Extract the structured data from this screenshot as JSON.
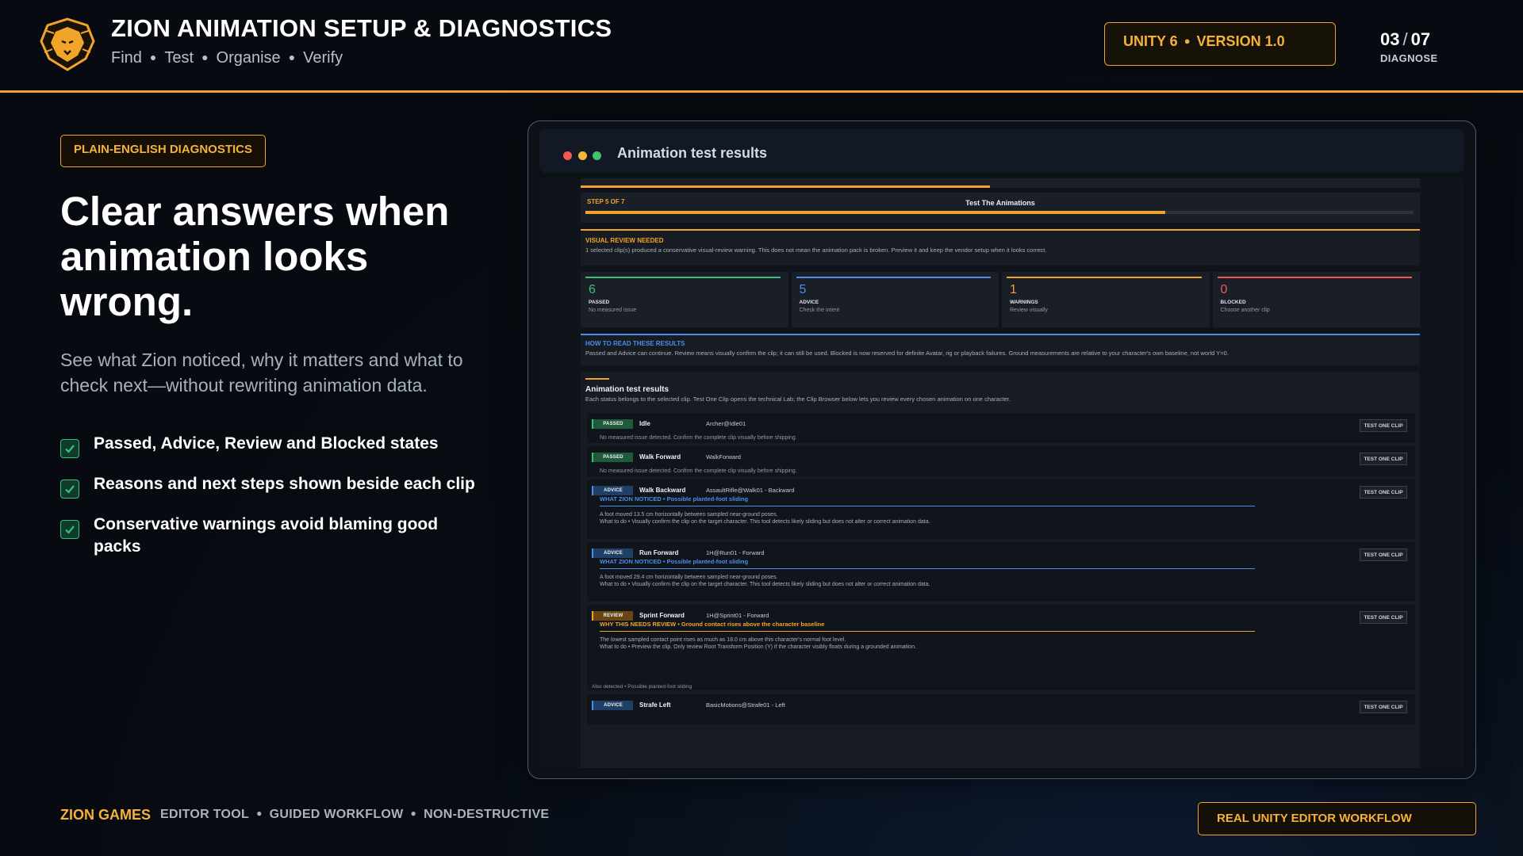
{
  "header": {
    "title": "ZION ANIMATION SETUP & DIAGNOSTICS",
    "subtitle_items": [
      "Find",
      "Test",
      "Organise",
      "Verify"
    ],
    "version_badge": [
      "UNITY 6",
      "VERSION 1.0"
    ],
    "page_current": "03",
    "page_total": "07",
    "page_label": "DIAGNOSE",
    "logo_icon": "lion-head-icon"
  },
  "left": {
    "tag": "PLAIN-ENGLISH DIAGNOSTICS",
    "headline": "Clear answers when animation looks wrong.",
    "lead": "See what Zion noticed, why it matters and what to check next—without rewriting animation data.",
    "features": [
      "Passed, Advice, Review and Blocked states",
      "Reasons and next steps shown beside each clip",
      "Conservative warnings avoid blaming good packs"
    ]
  },
  "footer": {
    "brand": "ZION GAMES",
    "tags": [
      "EDITOR TOOL",
      "GUIDED WORKFLOW",
      "NON-DESTRUCTIVE"
    ],
    "badge": "REAL UNITY EDITOR WORKFLOW"
  },
  "window": {
    "title": "Animation test results",
    "step_label": "STEP 5 OF 7",
    "step_title": "Test The Animations",
    "step_progress": 0.7,
    "review_banner": {
      "title": "VISUAL REVIEW NEEDED",
      "text": "1 selected clip(s) produced a conservative visual-review warning. This does not mean the animation pack is broken. Preview it and keep the vendor setup when it looks correct."
    },
    "stats": [
      {
        "value": "6",
        "label": "PASSED",
        "sub": "No measured issue",
        "color": "#35c07c"
      },
      {
        "value": "5",
        "label": "ADVICE",
        "sub": "Check the intent",
        "color": "#4a8ee8"
      },
      {
        "value": "1",
        "label": "WARNINGS",
        "sub": "Review visually",
        "color": "#f0a52a"
      },
      {
        "value": "0",
        "label": "BLOCKED",
        "sub": "Choose another clip",
        "color": "#ef5a4f"
      }
    ],
    "howto": {
      "title": "HOW TO READ THESE RESULTS",
      "text": "Passed and Advice can continue. Review means visually confirm the clip; it can still be used. Blocked is now reserved for definite Avatar, rig or playback failures. Ground measurements are relative to your character's own baseline, not world Y=0."
    },
    "results": {
      "title": "Animation test results",
      "desc": "Each status belongs to the selected clip. Test One Clip opens the technical Lab; the Clip Browser below lets you review every chosen animation on one character.",
      "button_label": "TEST ONE CLIP",
      "rows": [
        {
          "status": "PASSED",
          "name": "Idle",
          "file": "Archer@Idle01",
          "note": "No measured issue detected. Confirm the complete clip visually before shipping."
        },
        {
          "status": "PASSED",
          "name": "Walk Forward",
          "file": "WalkForward",
          "note": "No measured issue detected. Confirm the complete clip visually before shipping."
        },
        {
          "status": "ADVICE",
          "name": "Walk Backward",
          "file": "AssaultRifle@Walk01 - Backward",
          "detail_prefix": "WHAT ZION NOTICED",
          "detail_title": "Possible planted-foot sliding",
          "detail_line1": "A foot moved 13.5 cm horizontally between sampled near-ground poses.",
          "detail_line2": "What to do  •  Visually confirm the clip on the target character. This tool detects likely sliding but does not alter or correct animation data."
        },
        {
          "status": "ADVICE",
          "name": "Run Forward",
          "file": "1H@Run01 - Forward",
          "detail_prefix": "WHAT ZION NOTICED",
          "detail_title": "Possible planted-foot sliding",
          "detail_line1": "A foot moved 29.4 cm horizontally between sampled near-ground poses.",
          "detail_line2": "What to do  •  Visually confirm the clip on the target character. This tool detects likely sliding but does not alter or correct animation data."
        },
        {
          "status": "REVIEW",
          "name": "Sprint Forward",
          "file": "1H@Sprint01 - Forward",
          "detail_prefix": "WHY THIS NEEDS REVIEW",
          "detail_title": "Ground contact rises above the character baseline",
          "detail_line1": "The lowest sampled contact point rises as much as 18.0 cm above this character's normal foot level.",
          "detail_line2": "What to do  •  Preview the clip. Only review Root Transform Position (Y) if the character visibly floats during a grounded animation.",
          "also": "Also detected  •  Possible planted-foot sliding"
        },
        {
          "status": "ADVICE",
          "name": "Strafe Left",
          "file": "BasicMotions@Strafe01 - Left"
        }
      ]
    }
  },
  "colors": {
    "accent": "#f0a52a",
    "passed": "#35c07c",
    "advice": "#4a8ee8",
    "review": "#f0a52a",
    "blocked": "#ef5a4f"
  }
}
